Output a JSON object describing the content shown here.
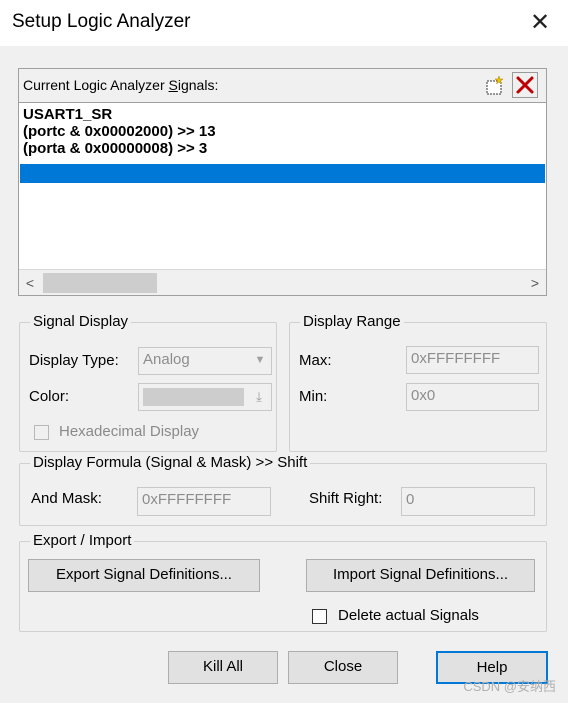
{
  "window": {
    "title": "Setup Logic Analyzer"
  },
  "signals": {
    "header_label_pre": "Current Logic Analyzer ",
    "header_label_u": "S",
    "header_label_post": "ignals:",
    "items": [
      "USART1_SR",
      "(portc & 0x00002000) >> 13",
      "(porta & 0x00000008) >> 3"
    ]
  },
  "signal_display": {
    "title": "Signal Display",
    "display_type_label": "Display Type:",
    "display_type_value": "Analog",
    "color_label": "Color:",
    "hex_display_label": "Hexadecimal Display"
  },
  "display_range": {
    "title": "Display Range",
    "max_label": "Max:",
    "max_value": "0xFFFFFFFF",
    "min_label": "Min:",
    "min_value": "0x0"
  },
  "formula": {
    "title": "Display Formula (Signal & Mask) >> Shift",
    "and_mask_label": "And Mask:",
    "and_mask_value": "0xFFFFFFFF",
    "shift_right_label": "Shift Right:",
    "shift_right_value": "0"
  },
  "export_import": {
    "title": "Export / Import",
    "export_button": "Export Signal Definitions...",
    "import_button": "Import Signal Definitions...",
    "delete_label": "Delete actual Signals"
  },
  "buttons": {
    "kill_all": "Kill All",
    "close": "Close",
    "help": "Help"
  },
  "watermark": "CSDN @安纳西",
  "colors": {
    "selection": "#0078d7",
    "delete_icon": "#c00000"
  }
}
